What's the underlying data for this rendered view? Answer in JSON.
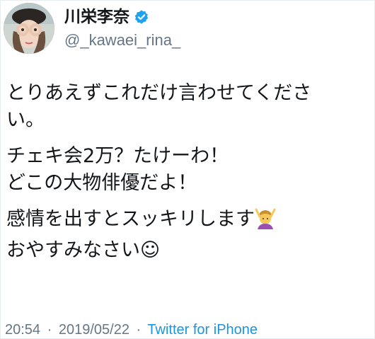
{
  "user": {
    "display_name": "川栄李奈",
    "handle": "@_kawaei_rina_",
    "verified_icon": "verified-badge-icon"
  },
  "tweet": {
    "para1_line1": "とりあえずこれだけ言わせてくださ",
    "para1_line2": "い。",
    "para2_line1": "チェキ会2万？たけーわ！",
    "para2_line2": "どこの大物俳優だよ！",
    "para3_line1": "感情を出すとスッキリします",
    "para3_emoji": "woman-gesturing-ok-icon",
    "para3_line2": "おやすみなさい",
    "para3_smiley": "☺"
  },
  "meta": {
    "time": "20:54",
    "separator1": "·",
    "date": "2019/05/22",
    "separator2": "·",
    "source": "Twitter for iPhone"
  },
  "colors": {
    "text": "#14171a",
    "secondary": "#657786",
    "link": "#1b95e0",
    "verified": "#1da1f2"
  }
}
